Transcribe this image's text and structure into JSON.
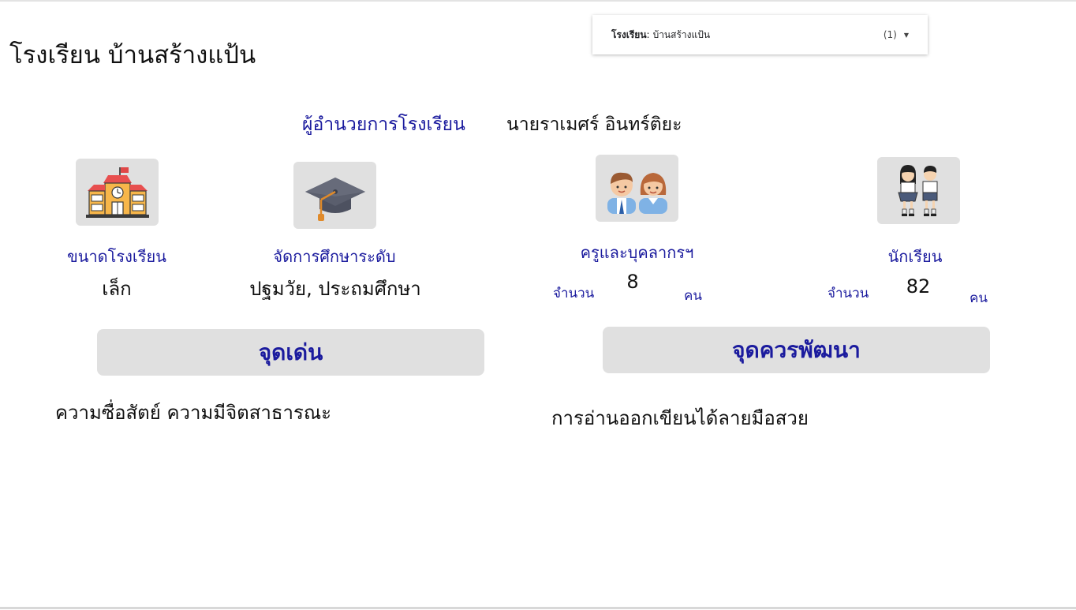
{
  "school": {
    "title": "โรงเรียน บ้านสร้างแป้น"
  },
  "filter": {
    "label": "โรงเรียน",
    "separator": ":",
    "value": "บ้านสร้างแป้น",
    "count": "(1)",
    "caret_icon": "caret-down-icon"
  },
  "director": {
    "label": "ผู้อำนวยการโรงเรียน",
    "name": "นายราเมศร์ อินทร์ติยะ"
  },
  "school_size": {
    "icon": "school-building-icon",
    "label": "ขนาดโรงเรียน",
    "value": "เล็ก"
  },
  "education_level": {
    "icon": "graduation-cap-icon",
    "label": "จัดการศึกษาระดับ",
    "value": "ปฐมวัย, ประถมศึกษา"
  },
  "staff": {
    "icon": "teachers-icon",
    "label": "ครูและบุคลากรฯ",
    "count_label": "จำนวน",
    "count": "8",
    "unit": "คน"
  },
  "students": {
    "icon": "students-icon",
    "label": "นักเรียน",
    "count_label": "จำนวน",
    "count": "82",
    "unit": "คน"
  },
  "strengths": {
    "title": "จุดเด่น",
    "text": "ความซื่อสัตย์ ความมีจิตสาธารณะ"
  },
  "improvements": {
    "title": "จุดควรพัฒนา",
    "text": "การอ่านออกเขียนได้ลายมือสวย"
  },
  "colors": {
    "accent": "#1b1b9e",
    "panel": "#e0e0e0",
    "text": "#111111"
  }
}
